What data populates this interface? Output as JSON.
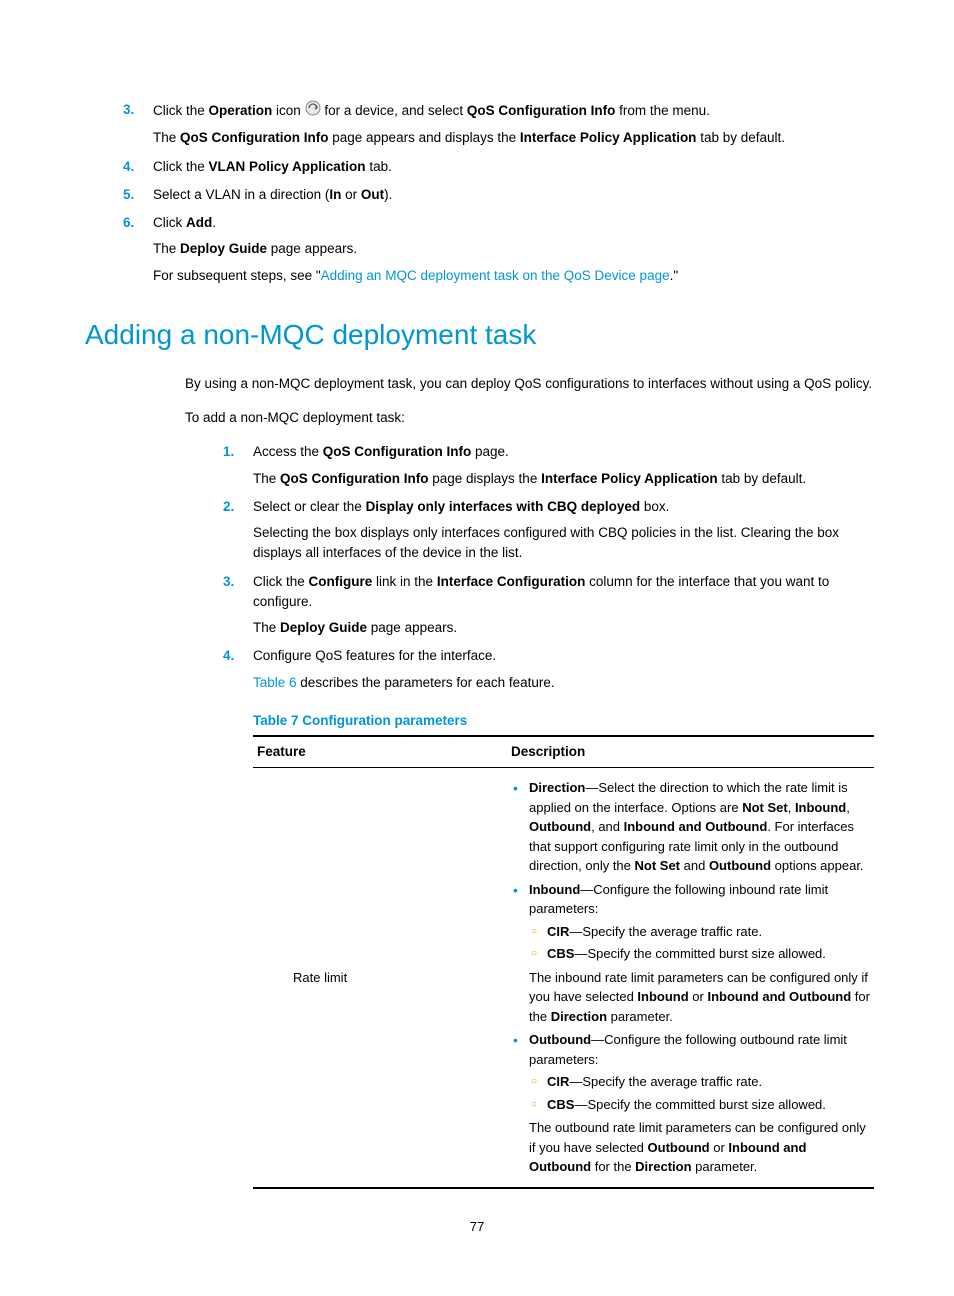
{
  "topSteps": {
    "s3": {
      "num": "3.",
      "line1_a": "Click the ",
      "line1_b": "Operation",
      "line1_c": " icon ",
      "line1_d": " for a device, and select ",
      "line1_e": "QoS Configuration Info",
      "line1_f": " from the menu.",
      "line2_a": "The ",
      "line2_b": "QoS Configuration Info",
      "line2_c": " page appears and displays the ",
      "line2_d": "Interface Policy Application",
      "line2_e": " tab by default."
    },
    "s4": {
      "num": "4.",
      "line1_a": "Click the ",
      "line1_b": "VLAN Policy Application",
      "line1_c": " tab."
    },
    "s5": {
      "num": "5.",
      "line1_a": "Select a VLAN in a direction (",
      "line1_b": "In",
      "line1_c": " or ",
      "line1_d": "Out",
      "line1_e": ")."
    },
    "s6": {
      "num": "6.",
      "line1_a": "Click ",
      "line1_b": "Add",
      "line1_c": ".",
      "line2_a": "The ",
      "line2_b": "Deploy Guide",
      "line2_c": " page appears.",
      "line3_a": "For subsequent steps, see \"",
      "line3_link": "Adding an MQC deployment task on the QoS Device page",
      "line3_b": ".\""
    }
  },
  "h2": "Adding a non-MQC deployment task",
  "introP1": "By using a non-MQC deployment task, you can deploy QoS configurations to interfaces without using a QoS policy.",
  "introP2": "To add a non-MQC deployment task:",
  "midSteps": {
    "s1": {
      "num": "1.",
      "line1_a": "Access the ",
      "line1_b": "QoS Configuration Info",
      "line1_c": " page.",
      "line2_a": "The ",
      "line2_b": "QoS Configuration Info",
      "line2_c": " page displays the ",
      "line2_d": "Interface Policy Application",
      "line2_e": " tab by default."
    },
    "s2": {
      "num": "2.",
      "line1_a": "Select or clear the ",
      "line1_b": "Display only interfaces with CBQ deployed",
      "line1_c": " box.",
      "line2": "Selecting the box displays only interfaces configured with CBQ policies in the list. Clearing the box displays all interfaces of the device in the list."
    },
    "s3": {
      "num": "3.",
      "line1_a": "Click the ",
      "line1_b": "Configure",
      "line1_c": " link in the ",
      "line1_d": "Interface Configuration",
      "line1_e": " column for the interface that you want to configure.",
      "line2_a": "The ",
      "line2_b": "Deploy Guide",
      "line2_c": " page appears."
    },
    "s4": {
      "num": "4.",
      "line1": "Configure QoS features for the interface.",
      "line2_link": "Table 6",
      "line2_b": " describes the parameters for each feature."
    }
  },
  "tableCaption": "Table 7 Configuration parameters",
  "table": {
    "h1": "Feature",
    "h2": "Description",
    "row1": {
      "feature": "Rate limit",
      "b1_a": "Direction",
      "b1_b": "—Select the direction to which the rate limit is applied on the interface. Options are ",
      "b1_c": "Not Set",
      "b1_d": ", ",
      "b1_e": "Inbound",
      "b1_f": ", ",
      "b1_g": "Outbound",
      "b1_h": ", and ",
      "b1_i": "Inbound and Outbound",
      "b1_j": ". For interfaces that support configuring rate limit only in the outbound direction, only the ",
      "b1_k": "Not Set",
      "b1_l": " and ",
      "b1_m": "Outbound",
      "b1_n": " options appear.",
      "b2_a": "Inbound",
      "b2_b": "—Configure the following inbound rate limit parameters:",
      "b2_cir_a": "CIR",
      "b2_cir_b": "—Specify the average traffic rate.",
      "b2_cbs_a": "CBS",
      "b2_cbs_b": "—Specify the committed burst size allowed.",
      "b2_note_a": "The inbound rate limit parameters can be configured only if you have selected ",
      "b2_note_b": "Inbound",
      "b2_note_c": " or ",
      "b2_note_d": "Inbound and Outbound",
      "b2_note_e": " for the ",
      "b2_note_f": "Direction",
      "b2_note_g": " parameter.",
      "b3_a": "Outbound",
      "b3_b": "—Configure the following outbound rate limit parameters:",
      "b3_cir_a": "CIR",
      "b3_cir_b": "—Specify the average traffic rate.",
      "b3_cbs_a": "CBS",
      "b3_cbs_b": "—Specify the committed burst size allowed.",
      "b3_note_a": "The outbound rate limit parameters can be configured only if you have selected ",
      "b3_note_b": "Outbound",
      "b3_note_c": " or ",
      "b3_note_d": "Inbound and Outbound",
      "b3_note_e": " for the ",
      "b3_note_f": "Direction",
      "b3_note_g": " parameter."
    }
  },
  "pageNumber": "77"
}
